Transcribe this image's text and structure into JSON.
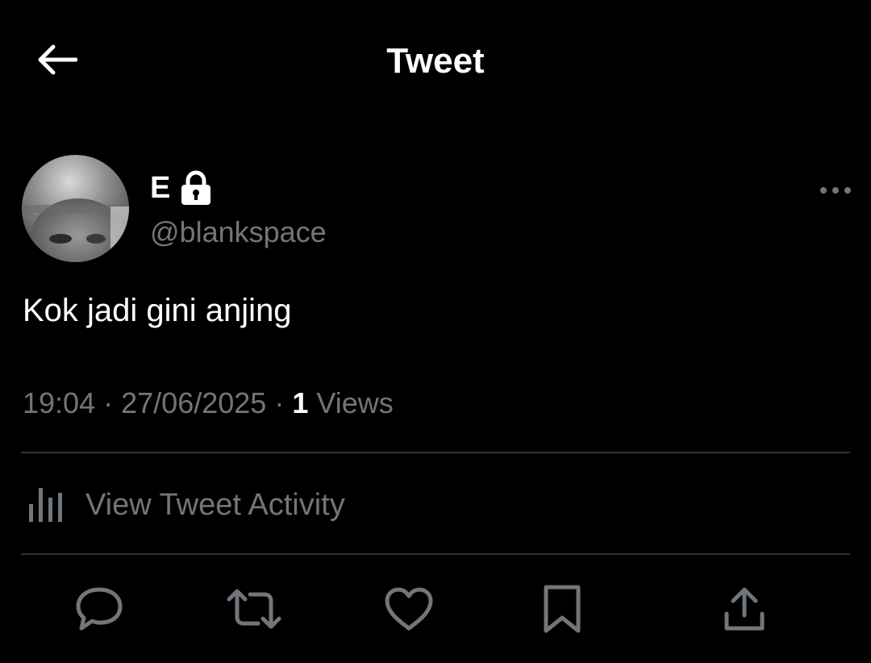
{
  "header": {
    "title": "Tweet",
    "back_icon": "arrow-left-icon"
  },
  "tweet": {
    "author": {
      "display_name": "E",
      "handle": "@blankspace",
      "protected_icon": "lock-icon"
    },
    "text": "Kok jadi gini anjing",
    "time": "19:04",
    "separator": "·",
    "date": "27/06/2025",
    "views_count": "1",
    "views_label": "Views",
    "more_icon": "ellipsis-icon"
  },
  "activity": {
    "label": "View Tweet Activity",
    "icon": "bar-chart-icon"
  },
  "actions": [
    {
      "name": "reply",
      "icon": "reply-icon"
    },
    {
      "name": "retweet",
      "icon": "retweet-icon"
    },
    {
      "name": "like",
      "icon": "heart-icon"
    },
    {
      "name": "bookmark",
      "icon": "bookmark-icon"
    },
    {
      "name": "share",
      "icon": "share-icon"
    }
  ],
  "colors": {
    "background": "#000000",
    "text_primary": "#ffffff",
    "text_secondary": "#71767b",
    "divider": "#2f3336"
  }
}
